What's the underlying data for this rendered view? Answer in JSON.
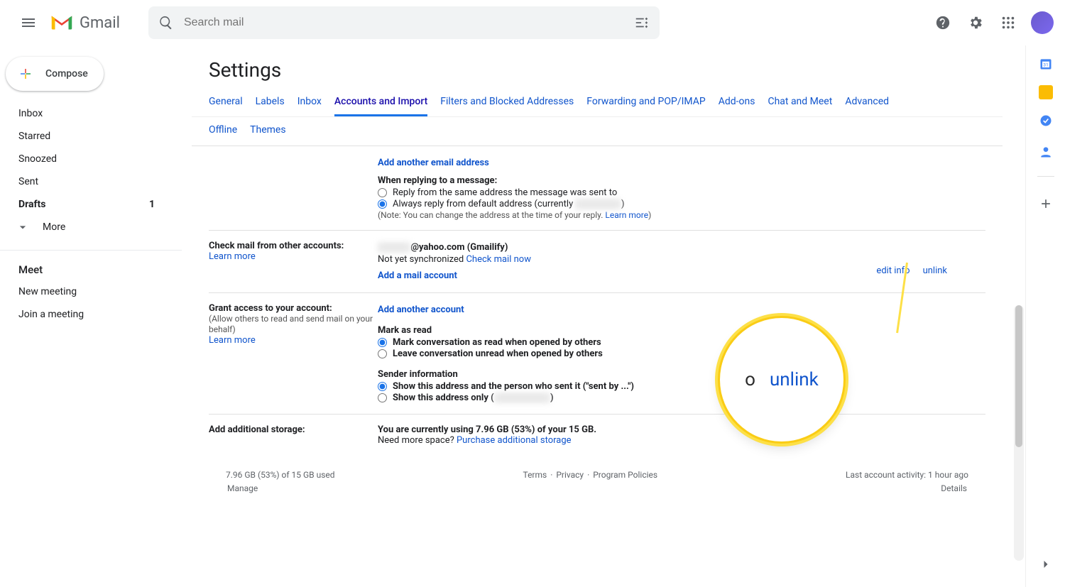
{
  "app_logo_text": "Gmail",
  "search_placeholder": "Search mail",
  "compose_label": "Compose",
  "sidebar": {
    "items": [
      {
        "label": "Inbox",
        "count": ""
      },
      {
        "label": "Starred",
        "count": ""
      },
      {
        "label": "Snoozed",
        "count": ""
      },
      {
        "label": "Sent",
        "count": ""
      },
      {
        "label": "Drafts",
        "count": "1",
        "bold": true
      }
    ],
    "more_label": "More"
  },
  "meet": {
    "header": "Meet",
    "new_meeting": "New meeting",
    "join_meeting": "Join a meeting"
  },
  "page_title": "Settings",
  "tabs": [
    {
      "label": "General"
    },
    {
      "label": "Labels"
    },
    {
      "label": "Inbox"
    },
    {
      "label": "Accounts and Import",
      "active": true
    },
    {
      "label": "Filters and Blocked Addresses"
    },
    {
      "label": "Forwarding and POP/IMAP"
    },
    {
      "label": "Add-ons"
    },
    {
      "label": "Chat and Meet"
    },
    {
      "label": "Advanced"
    }
  ],
  "tabs2": [
    {
      "label": "Offline"
    },
    {
      "label": "Themes"
    }
  ],
  "section_sendas": {
    "add_another_email": "Add another email address",
    "reply_header": "When replying to a message:",
    "radio_same": "Reply from the same address the message was sent to",
    "radio_default_pre": "Always reply from default address (currently ",
    "radio_default_blur": "xxxxxxxxxx",
    "radio_default_post": ")",
    "note_pre": "(Note: You can change the address at the time of your reply. ",
    "note_learn": "Learn more",
    "note_post": ")"
  },
  "section_check": {
    "left_title": "Check mail from other accounts:",
    "learn_more": "Learn more",
    "right_addr_blur": "xxxxxxx",
    "right_addr_suffix": "@yahoo.com (Gmailify)",
    "not_sync": "Not yet synchronized   ",
    "check_now": "Check mail now",
    "add_mail": "Add a mail account",
    "edit_info": "edit info",
    "unlink": "unlink"
  },
  "section_grant": {
    "left_title": "Grant access to your account:",
    "left_sub": "(Allow others to read and send mail on your behalf)",
    "learn_more": "Learn more",
    "add_account": "Add another account",
    "mark_header": "Mark as read",
    "radio_mark": "Mark conversation as read when opened by others",
    "radio_leave": "Leave conversation unread when opened by others",
    "sender_header": "Sender information",
    "radio_show_sent_pre": "Show this address and the person who sent it (\"sent by ...\")",
    "radio_show_only_pre": "Show this address only (",
    "radio_show_only_blur": "xxxxxxxxxxxx",
    "radio_show_only_post": ")"
  },
  "section_storage": {
    "left_title": "Add additional storage:",
    "line1": "You are currently using 7.96 GB (53%) of your 15 GB.",
    "line2_pre": "Need more space? ",
    "line2_link": "Purchase additional storage"
  },
  "footer": {
    "left_line": "7.96 GB (53%) of 15 GB used",
    "left_link": "Manage",
    "mid_terms": "Terms",
    "mid_privacy": "Privacy",
    "mid_policies": "Program Policies",
    "dot": "·",
    "right_line": "Last account activity: 1 hour ago",
    "right_link": "Details"
  },
  "mag": {
    "left": "o",
    "right": "unlink"
  }
}
